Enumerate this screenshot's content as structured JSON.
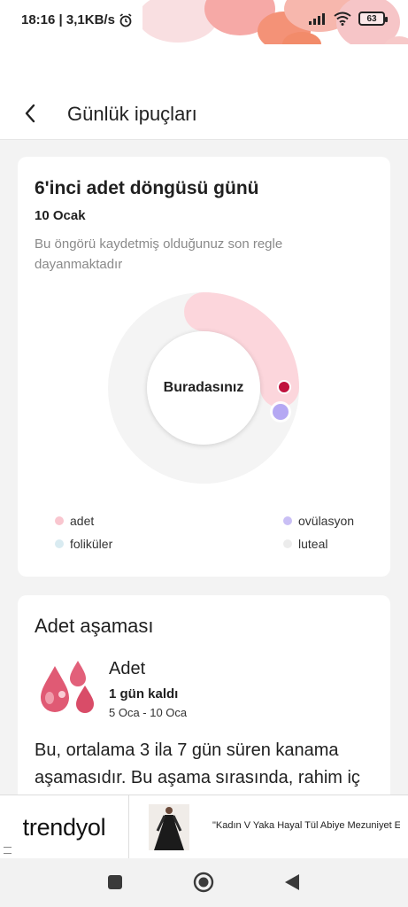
{
  "status_bar": {
    "time": "18:16 | 3,1KB/s",
    "battery": "63"
  },
  "header": {
    "title": "Günlük ipuçları"
  },
  "cycle_card": {
    "title": "6'inci adet döngüsü günü",
    "date": "10 Ocak",
    "note": "Bu öngörü kaydetmiş olduğunuz son regle dayanmaktadır",
    "center_label": "Buradasınız",
    "legend": [
      {
        "label": "adet",
        "color": "#f9c6cf"
      },
      {
        "label": "ovülasyon",
        "color": "#c9bff5"
      },
      {
        "label": "foliküler",
        "color": "#d9ebf1"
      },
      {
        "label": "luteal",
        "color": "#ececec"
      }
    ],
    "colors": {
      "period_arc": "#fcd6dc",
      "ring_bg": "#f4f4f4",
      "current_marker": "#c0133e",
      "ovulation_marker": "#b5a8f3"
    }
  },
  "phase_card": {
    "heading": "Adet aşaması",
    "phase_name": "Adet",
    "days_left": "1 gün kaldı",
    "date_range": "5 Oca - 10 Oca",
    "description": "Bu, ortalama 3 ila 7 gün süren kanama aşamasıdır. Bu aşama sırasında, rahim iç"
  },
  "ad": {
    "brand": "trendyol",
    "text": "\"Kadın V Yaka Hayal Tül Abiye Mezuniyet Elb..."
  },
  "icons": {
    "back": "chevron-left-icon",
    "nav_recents": "square-icon",
    "nav_home": "circle-icon",
    "nav_back": "triangle-back-icon"
  }
}
